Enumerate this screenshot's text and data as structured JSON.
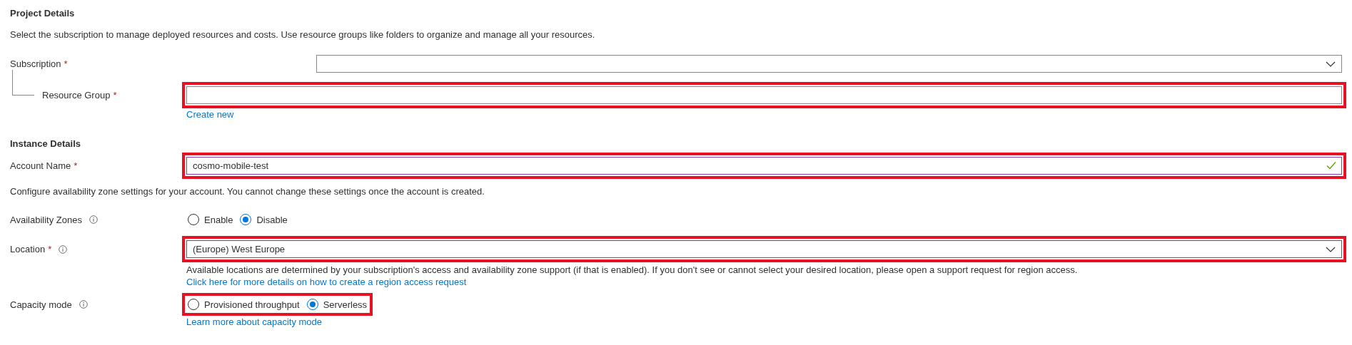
{
  "required_marker": "*",
  "sections": [
    {
      "title": "Project Details",
      "items": [
        {
          "kind": "note",
          "text": "Select the subscription to manage deployed resources and costs. Use resource groups like folders to organize and manage all your resources."
        },
        {
          "kind": "select",
          "label": "Subscription",
          "required": true,
          "info": false,
          "highlighted": false,
          "edited": false,
          "children": [
            {
              "kind": "text",
              "label": "Resource Group",
              "required": true,
              "info": false,
              "highlighted": true,
              "edited": false,
              "valid": false,
              "link": "Create new"
            }
          ]
        }
      ]
    },
    {
      "title": "Instance Details",
      "items": [
        {
          "kind": "text",
          "label": "Account Name",
          "required": true,
          "info": false,
          "highlighted": true,
          "edited": true,
          "valid": true,
          "value": "cosmo-mobile-test"
        },
        {
          "kind": "note",
          "text": "Configure availability zone settings for your account. You cannot change these settings once the account is created."
        },
        {
          "kind": "radio",
          "label": "Availability Zones",
          "required": false,
          "info": true,
          "highlighted": false,
          "options": [
            {
              "label": "Enable",
              "selected": false
            },
            {
              "label": "Disable",
              "selected": true
            }
          ]
        },
        {
          "kind": "select",
          "label": "Location",
          "required": true,
          "info": true,
          "highlighted": true,
          "edited": true,
          "value": "(Europe) West Europe",
          "help": "Available locations are determined by your subscription's access and availability zone support (if that is enabled). If you don't see or cannot select your desired location, please open a support request for region access.",
          "link": "Click here for more details on how to create a region access request"
        },
        {
          "kind": "radio",
          "label": "Capacity mode",
          "required": false,
          "info": true,
          "highlighted": true,
          "options": [
            {
              "label": "Provisioned throughput",
              "selected": false
            },
            {
              "label": "Serverless",
              "selected": true
            }
          ],
          "link": "Learn more about capacity mode"
        }
      ]
    }
  ]
}
